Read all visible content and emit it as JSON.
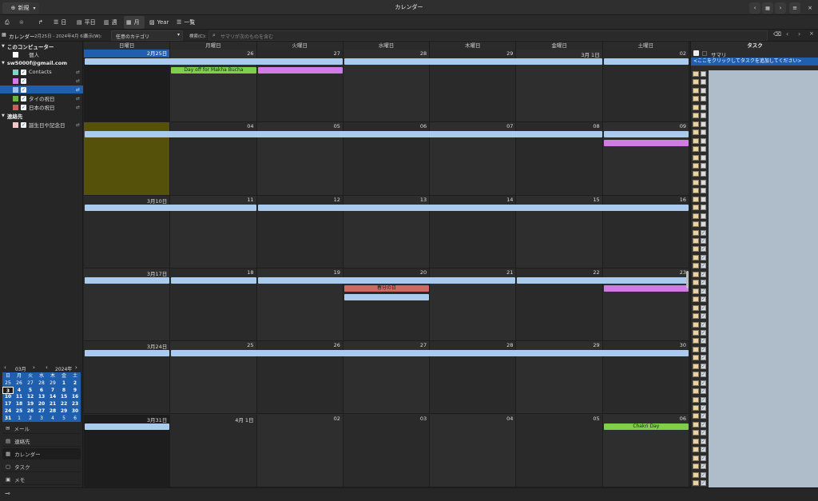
{
  "window": {
    "title": "カレンダー",
    "new_label": "新規"
  },
  "toolbar": {
    "views": [
      {
        "label": "日"
      },
      {
        "label": "平日"
      },
      {
        "label": "週"
      },
      {
        "label": "月"
      },
      {
        "label": "Year"
      },
      {
        "label": "一覧"
      }
    ]
  },
  "filter": {
    "sidebar_title": "カレンダー",
    "range": "2月25日 - 2024年4月 6日",
    "show_label": "表示(W):",
    "category": "任意のカテゴリ",
    "search_label": "検索(C):",
    "search_placeholder": "サマリが次のものを含む"
  },
  "sidebar": {
    "groups": [
      {
        "title": "このコンピューター",
        "items": [
          {
            "label": "個人",
            "color": "#ffffff",
            "checked": false
          }
        ]
      },
      {
        "title": "sw5000f@gmail.com",
        "items": [
          {
            "label": "Contacts",
            "color": "#7fd6c6",
            "checked": true
          },
          {
            "label": "",
            "color": "#d57be6",
            "checked": true
          },
          {
            "label": "",
            "color": "#9cc4ec",
            "checked": true,
            "selected": true
          },
          {
            "label": "タイの祝日",
            "color": "#6db33f",
            "checked": true
          },
          {
            "label": "日本の祝日",
            "color": "#c9615b",
            "checked": true
          }
        ]
      },
      {
        "title": "連絡先",
        "items": [
          {
            "label": "誕生日や記念日",
            "color": "#f2c6c6",
            "checked": true
          }
        ]
      }
    ]
  },
  "mini": {
    "month": "03月",
    "year": "2024年",
    "weekdays": [
      "日",
      "月",
      "火",
      "水",
      "木",
      "金",
      "土"
    ],
    "weeks": [
      [
        "25",
        "26",
        "27",
        "28",
        "29",
        "1",
        "2"
      ],
      [
        "3",
        "4",
        "5",
        "6",
        "7",
        "8",
        "9"
      ],
      [
        "10",
        "11",
        "12",
        "13",
        "14",
        "15",
        "16"
      ],
      [
        "17",
        "18",
        "19",
        "20",
        "21",
        "22",
        "23"
      ],
      [
        "24",
        "25",
        "26",
        "27",
        "28",
        "29",
        "30"
      ],
      [
        "31",
        "1",
        "2",
        "3",
        "4",
        "5",
        "6"
      ]
    ]
  },
  "nav": [
    {
      "label": "メール"
    },
    {
      "label": "連絡先"
    },
    {
      "label": "カレンダー"
    },
    {
      "label": "タスク"
    },
    {
      "label": "メモ"
    }
  ],
  "calendar": {
    "weekdays": [
      "日曜日",
      "月曜日",
      "火曜日",
      "水曜日",
      "木曜日",
      "金曜日",
      "土曜日"
    ],
    "weeks": [
      [
        "2月25日",
        "26",
        "27",
        "28",
        "29",
        "3月 1日",
        "02"
      ],
      [
        "03",
        "04",
        "05",
        "06",
        "07",
        "08",
        "09"
      ],
      [
        "3月10日",
        "11",
        "12",
        "13",
        "14",
        "15",
        "16"
      ],
      [
        "3月17日",
        "18",
        "19",
        "20",
        "21",
        "22",
        "23"
      ],
      [
        "3月24日",
        "25",
        "26",
        "27",
        "28",
        "29",
        "30"
      ],
      [
        "3月31日",
        "4月 1日",
        "02",
        "03",
        "04",
        "05",
        "06"
      ]
    ],
    "events": [
      {
        "week": 0,
        "row": 0,
        "start": 0,
        "end": 2,
        "label": "",
        "color": "#a8cbee"
      },
      {
        "week": 0,
        "row": 0,
        "start": 3,
        "end": 5,
        "label": "",
        "color": "#a8cbee"
      },
      {
        "week": 0,
        "row": 0,
        "start": 6,
        "end": 6,
        "label": "",
        "color": "#a8cbee"
      },
      {
        "week": 0,
        "row": 1,
        "start": 1,
        "end": 1,
        "label": "Day off for Makha Bucha",
        "color": "#7ed04a"
      },
      {
        "week": 0,
        "row": 1,
        "start": 2,
        "end": 2,
        "label": "",
        "color": "#d17be4"
      },
      {
        "week": 1,
        "row": 0,
        "start": 0,
        "end": 5,
        "label": "",
        "color": "#a8cbee"
      },
      {
        "week": 1,
        "row": 0,
        "start": 6,
        "end": 6,
        "label": "",
        "color": "#a8cbee"
      },
      {
        "week": 1,
        "row": 1,
        "start": 6,
        "end": 6,
        "label": "",
        "color": "#d17be4"
      },
      {
        "week": 2,
        "row": 0,
        "start": 0,
        "end": 1,
        "label": "",
        "color": "#a8cbee"
      },
      {
        "week": 2,
        "row": 0,
        "start": 2,
        "end": 6,
        "label": "",
        "color": "#a8cbee"
      },
      {
        "week": 3,
        "row": 0,
        "start": 0,
        "end": 0,
        "label": "",
        "color": "#a8cbee"
      },
      {
        "week": 3,
        "row": 0,
        "start": 1,
        "end": 1,
        "label": "",
        "color": "#a8cbee"
      },
      {
        "week": 3,
        "row": 0,
        "start": 2,
        "end": 4,
        "label": "",
        "color": "#a8cbee"
      },
      {
        "week": 3,
        "row": 0,
        "start": 5,
        "end": 6,
        "label": "",
        "color": "#a8cbee"
      },
      {
        "week": 3,
        "row": 1,
        "start": 3,
        "end": 3,
        "label": "春分の日",
        "color": "#cf6a63"
      },
      {
        "week": 3,
        "row": 1,
        "start": 6,
        "end": 6,
        "label": "",
        "color": "#d17be4"
      },
      {
        "week": 3,
        "row": 2,
        "start": 3,
        "end": 3,
        "label": "",
        "color": "#a8cbee"
      },
      {
        "week": 4,
        "row": 0,
        "start": 0,
        "end": 0,
        "label": "",
        "color": "#a8cbee"
      },
      {
        "week": 4,
        "row": 0,
        "start": 1,
        "end": 6,
        "label": "",
        "color": "#a8cbee"
      },
      {
        "week": 5,
        "row": 0,
        "start": 0,
        "end": 0,
        "label": "",
        "color": "#a8cbee"
      },
      {
        "week": 5,
        "row": 0,
        "start": 6,
        "end": 6,
        "label": "Chakri Day",
        "color": "#7ed04a"
      }
    ]
  },
  "tasks": {
    "title": "タスク",
    "summary_col": "サマリ",
    "add_hint": "<ここをクリックしてタスクを追加してください>",
    "row_count": 50,
    "checked_from": 19
  }
}
